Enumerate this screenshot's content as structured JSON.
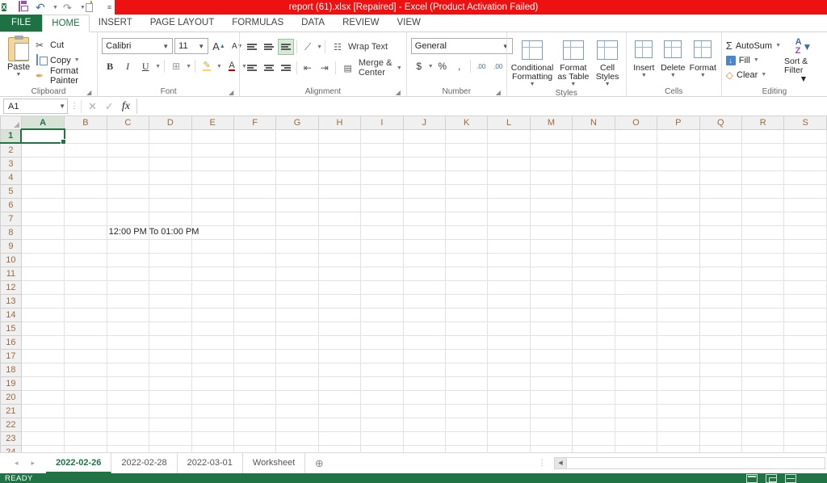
{
  "titlebar": {
    "title": "report (61).xlsx [Repaired]  -  Excel (Product Activation Failed)",
    "quick_access": [
      {
        "name": "excel-logo",
        "label": "X"
      },
      {
        "name": "save-icon",
        "label": ""
      },
      {
        "name": "undo-icon",
        "label": "↶"
      },
      {
        "name": "redo-icon",
        "label": "↷"
      },
      {
        "name": "touch-mode-icon",
        "label": ""
      },
      {
        "name": "customize-qat-icon",
        "label": "≡"
      }
    ],
    "bg_color": "#ee1111"
  },
  "ribbon": {
    "tabs": [
      {
        "label": "FILE",
        "active": false
      },
      {
        "label": "HOME",
        "active": true
      },
      {
        "label": "INSERT",
        "active": false
      },
      {
        "label": "PAGE LAYOUT",
        "active": false
      },
      {
        "label": "FORMULAS",
        "active": false
      },
      {
        "label": "DATA",
        "active": false
      },
      {
        "label": "REVIEW",
        "active": false
      },
      {
        "label": "VIEW",
        "active": false
      }
    ],
    "clipboard": {
      "group_label": "Clipboard",
      "paste_label": "Paste",
      "cut_label": "Cut",
      "copy_label": "Copy",
      "format_painter_label": "Format Painter"
    },
    "font": {
      "group_label": "Font",
      "font_name": "Calibri",
      "font_size": "11",
      "grow_font": "A",
      "shrink_font": "A",
      "bold": "B",
      "italic": "I",
      "underline": "U",
      "borders": "⊞",
      "fill_color": "A",
      "font_color": "A"
    },
    "alignment": {
      "group_label": "Alignment",
      "wrap_text_label": "Wrap Text",
      "merge_center_label": "Merge & Center",
      "orientation": "⟋"
    },
    "number": {
      "group_label": "Number",
      "format_value": "General",
      "accounting": "$",
      "percent": "%",
      "comma": ",",
      "increase_decimal": ".00",
      "decrease_decimal": ".00"
    },
    "styles": {
      "group_label": "Styles",
      "conditional_formatting": "Conditional Formatting",
      "format_as_table": "Format as Table",
      "cell_styles": "Cell Styles"
    },
    "cells": {
      "group_label": "Cells",
      "insert": "Insert",
      "delete": "Delete",
      "format": "Format"
    },
    "editing": {
      "group_label": "Editing",
      "autosum": "AutoSum",
      "fill": "Fill",
      "clear": "Clear",
      "sort_filter": "Sort & Filter"
    }
  },
  "formula_bar": {
    "name_box": "A1",
    "cancel": "✕",
    "enter": "✓",
    "insert_function": "fx",
    "formula_value": "",
    "placeholder": ""
  },
  "grid": {
    "columns": [
      "A",
      "B",
      "C",
      "D",
      "E",
      "F",
      "G",
      "H",
      "I",
      "J",
      "K",
      "L",
      "M",
      "N",
      "O",
      "P",
      "Q",
      "R",
      "S"
    ],
    "rows": [
      1,
      2,
      3,
      4,
      5,
      6,
      7,
      8,
      9,
      10,
      11,
      12,
      13,
      14,
      15,
      16,
      17,
      18,
      19,
      20,
      21,
      22,
      23,
      24
    ],
    "selected_cell": "A1",
    "selected_column": "A",
    "selected_row": 1,
    "cells": [
      {
        "ref": "C8",
        "row": 8,
        "col": "C",
        "value": "12:00 PM To 01:00 PM"
      }
    ]
  },
  "sheet_tabs": {
    "prev_label": "◂",
    "next_label": "▸",
    "tabs": [
      {
        "label": "2022-02-26",
        "active": true
      },
      {
        "label": "2022-02-28",
        "active": false
      },
      {
        "label": "2022-03-01",
        "active": false
      },
      {
        "label": "Worksheet",
        "active": false
      }
    ],
    "add_sheet_label": "⊕"
  },
  "status_bar": {
    "status": "READY",
    "views": [
      "normal-view-icon",
      "page-layout-view-icon",
      "page-break-view-icon"
    ],
    "bg_color": "#217346"
  }
}
